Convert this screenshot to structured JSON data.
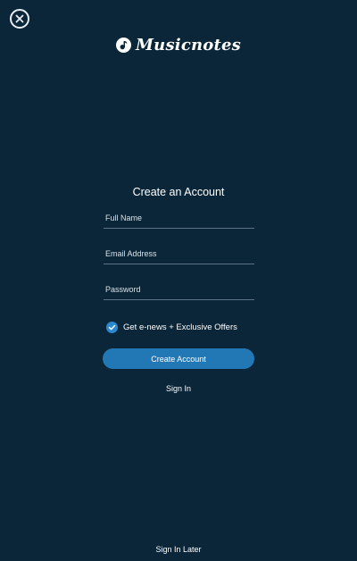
{
  "app": {
    "logo_text": "Musicnotes"
  },
  "form": {
    "title": "Create an Account",
    "full_name_placeholder": "Full Name",
    "email_placeholder": "Email Address",
    "password_placeholder": "Password",
    "newsletter_label": "Get e-news + Exclusive Offers",
    "newsletter_checked": true,
    "create_button_label": "Create Account",
    "sign_in_label": "Sign In"
  },
  "footer": {
    "sign_in_later_label": "Sign In Later"
  },
  "colors": {
    "background": "#0b2638",
    "accent": "#2278b5",
    "checkbox": "#2a8ad1"
  },
  "icons": {
    "close": "close-icon",
    "logo": "music-note-icon",
    "check": "checkmark-icon"
  }
}
